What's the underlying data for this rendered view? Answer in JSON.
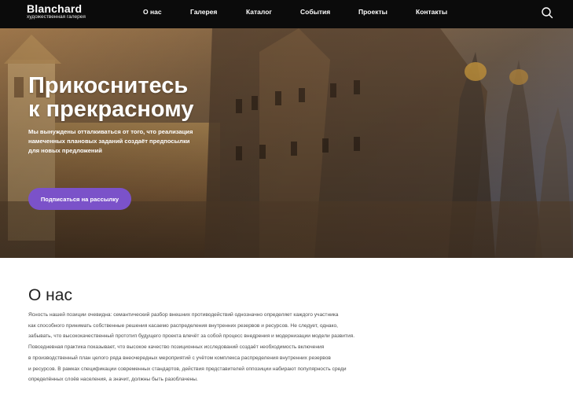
{
  "brand": {
    "title": "Blanchard",
    "subtitle": "художественная галерея"
  },
  "nav": {
    "items": [
      {
        "label": "О нас"
      },
      {
        "label": "Галерея"
      },
      {
        "label": "Каталог"
      },
      {
        "label": "События"
      },
      {
        "label": "Проекты"
      },
      {
        "label": "Контакты"
      }
    ],
    "search_icon": "search-icon"
  },
  "hero": {
    "title_line1": "Прикоснитесь",
    "title_line2": "к прекрасному",
    "text_line1": "Мы вынуждены отталкиваться от того, что реализация",
    "text_line2": "намеченных плановых заданий создаёт предпосылки",
    "text_line3": "для новых предложений",
    "button_label": "Подписаться на рассылку",
    "button_color": "#7b52c9"
  },
  "about": {
    "title": "О нас",
    "lines": [
      "Ясность нашей позиции очевидна: семантический разбор внешних противодействий однозначно определяет каждого участника",
      "как способного принимать собственные решения касаемо распределения внутренних резервов и ресурсов. Не следует, однако,",
      "забывать, что высококачественный прототип будущего проекта влечёт за собой процесс внедрения и модернизации модели развития.",
      "Повседневная практика показывает, что высокое качество позиционных исследований создаёт необходимость включения",
      "в производственный план целого ряда внеочередных мероприятий с учётом комплекса распределения внутренних резервов",
      "и ресурсов. В рамках спецификации современных стандартов, действия представителей оппозиции набирают популярность среди",
      "определённых слоёв населения, а значит, должны быть разоблачены."
    ]
  }
}
